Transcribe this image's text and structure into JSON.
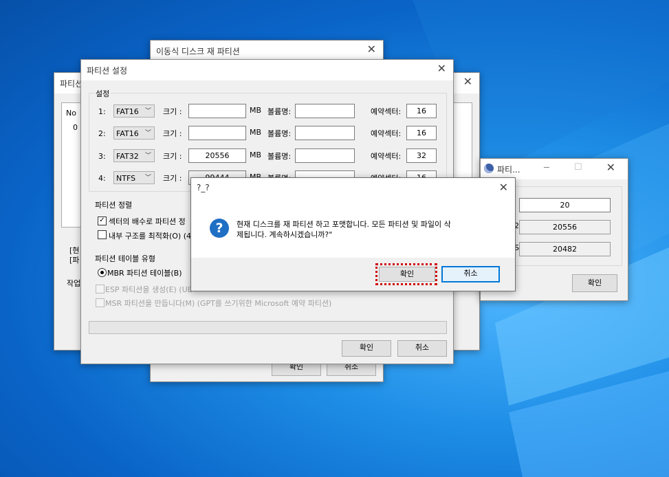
{
  "colors": {
    "accent": "#0078d7",
    "focus_dotted": "#d00000",
    "desktop": "#0a64c8"
  },
  "back_window": {
    "title": "파티션",
    "list_header": "No",
    "list_row": "0",
    "info_line1": "[현",
    "info_line2": "[파",
    "task_label": "작업"
  },
  "main_window": {
    "title": "이동식 디스크 재 파티션",
    "ok": "확인",
    "cancel": "취소"
  },
  "right_window": {
    "title": "파티...",
    "icon": "disk-icon",
    "values": [
      "20",
      "20556",
      "20482"
    ],
    "label_2": "2",
    "label_3": "S",
    "ok": "확인"
  },
  "settings_window": {
    "title": "파티션 설정",
    "group_settings": "설정",
    "labels": {
      "size": "크기 :",
      "mb": "MB",
      "volume": "볼륨명:",
      "reserved": "예약섹터:"
    },
    "rows": [
      {
        "num": "1:",
        "fs": "FAT16",
        "size": "",
        "volume": "",
        "reserved": "16"
      },
      {
        "num": "2:",
        "fs": "FAT16",
        "size": "",
        "volume": "",
        "reserved": "16"
      },
      {
        "num": "3:",
        "fs": "FAT32",
        "size": "20556",
        "volume": "",
        "reserved": "32"
      },
      {
        "num": "4:",
        "fs": "NTFS",
        "size": "99444",
        "volume": "",
        "reserved": "16"
      }
    ],
    "group_align": "파티션 정렬",
    "align_sector": "섹터의 배수로 파티션 정",
    "align_internal": "내부 구조를 최적화(O) (4",
    "group_table": "파티션 테이블 유형",
    "mbr": "MBR 파티션 테이블(B)",
    "esp": "ESP 파티션을 생성(E) (UE",
    "msr": "MSR 파티션을 만듭니다(M) (GPT를 쓰기위한 Microsoft 예약 파티션)",
    "ok": "확인",
    "cancel": "취소"
  },
  "dialog": {
    "title": "?_?",
    "icon": "question-icon",
    "message_line1": "현재 디스크를 재 파티션 하고 포맷합니다. 모든 파티션 및 파일이 삭",
    "message_line2": "제됩니다. 계속하시겠습니까?\"",
    "ok": "확인",
    "cancel": "취소"
  }
}
